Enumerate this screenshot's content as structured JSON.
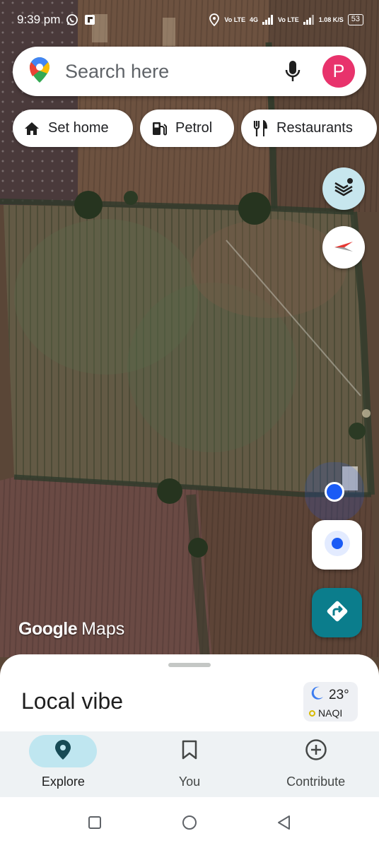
{
  "status_bar": {
    "time": "9:39 pm",
    "sim1": "Vo LTE",
    "network": "4G",
    "sim2": "Vo LTE",
    "speed": "1.08 K/S",
    "battery": "53"
  },
  "search": {
    "placeholder": "Search here",
    "avatar_letter": "P"
  },
  "chips": [
    {
      "label": "Set home",
      "icon": "home-icon"
    },
    {
      "label": "Petrol",
      "icon": "fuel-icon"
    },
    {
      "label": "Restaurants",
      "icon": "restaurant-icon"
    }
  ],
  "map": {
    "watermark_brand": "Google",
    "watermark_product": "Maps"
  },
  "sheet": {
    "title": "Local vibe",
    "temperature": "23°",
    "air_quality": "NAQI"
  },
  "bottom_nav": [
    {
      "label": "Explore",
      "icon": "explore-pin-icon",
      "active": true
    },
    {
      "label": "You",
      "icon": "bookmark-icon",
      "active": false
    },
    {
      "label": "Contribute",
      "icon": "add-circle-icon",
      "active": false
    }
  ],
  "colors": {
    "accent": "#0b7d8c",
    "avatar": "#e8336c",
    "location_blue": "#1a5bf5",
    "nav_active_pill": "#bfe6f0"
  }
}
